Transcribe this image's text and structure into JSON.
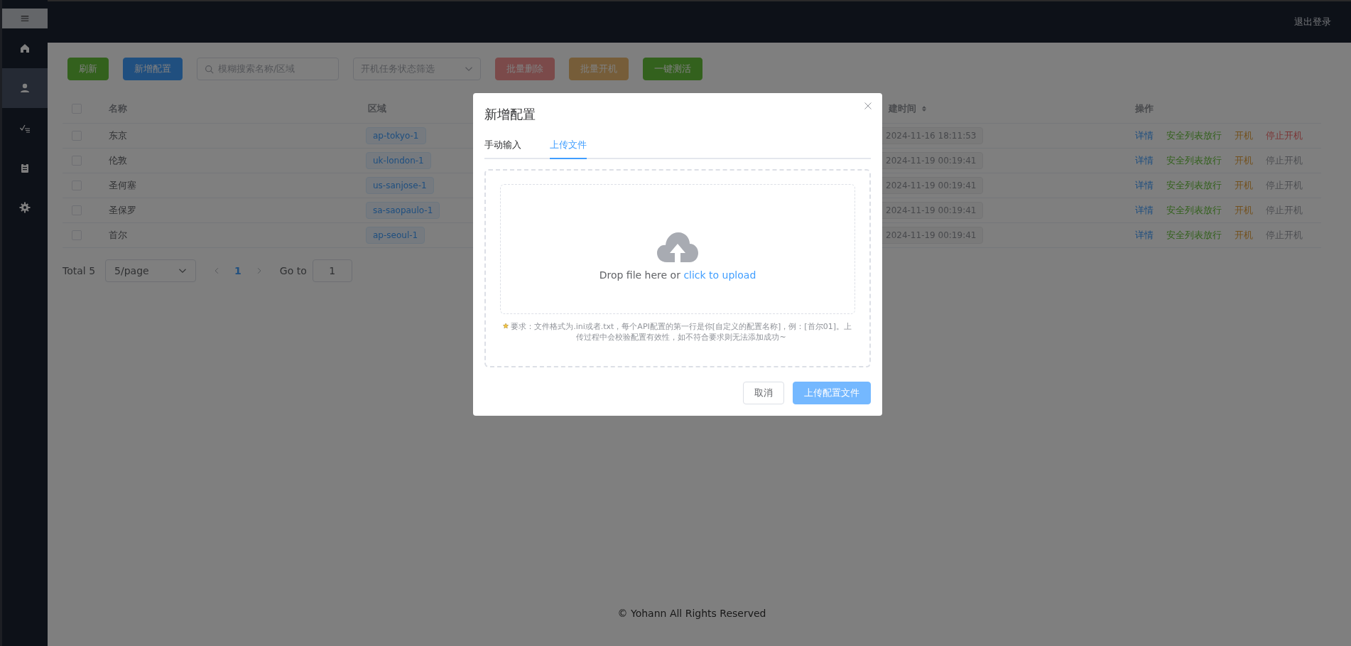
{
  "sidebar": {
    "collapsed": true,
    "items": [
      {
        "selected": false
      },
      {
        "selected": true
      },
      {
        "selected": false
      },
      {
        "selected": false
      },
      {
        "selected": false
      }
    ]
  },
  "header": {
    "logout": "退出登录"
  },
  "toolbar": {
    "buttons": [
      {
        "label": "刷新",
        "kind": "success",
        "disabled": false
      },
      {
        "label": "新增配置",
        "kind": "primary",
        "disabled": false
      }
    ],
    "search": {
      "placeholder": "模糊搜索名称/区域"
    },
    "status_filter": {
      "placeholder": "开机任务状态筛选"
    },
    "batch_buttons": [
      {
        "label": "批量删除",
        "kind": "danger",
        "disabled": true
      },
      {
        "label": "批量开机",
        "kind": "warning",
        "disabled": true
      },
      {
        "label": "一键测活",
        "kind": "success",
        "disabled": false
      }
    ]
  },
  "table": {
    "columns": [
      "名称",
      "区域",
      "建时间",
      "操作"
    ],
    "select_all_checked": false,
    "rows": [
      {
        "checked": false,
        "name": "东京",
        "region": "ap-tokyo-1",
        "created": "2024-11-16 18:11:53",
        "actions": [
          {
            "label": "详情",
            "kind": "info",
            "disabled": false
          },
          {
            "label": "安全列表放行",
            "kind": "success",
            "disabled": false
          },
          {
            "label": "开机",
            "kind": "warning",
            "disabled": false
          },
          {
            "label": "停止开机",
            "kind": "danger",
            "disabled": false
          }
        ]
      },
      {
        "checked": false,
        "name": "伦敦",
        "region": "uk-london-1",
        "created": "2024-11-19 00:19:41",
        "actions": [
          {
            "label": "详情",
            "kind": "info",
            "disabled": false
          },
          {
            "label": "安全列表放行",
            "kind": "success",
            "disabled": false
          },
          {
            "label": "开机",
            "kind": "warning",
            "disabled": false
          },
          {
            "label": "停止开机",
            "kind": "danger",
            "disabled": true
          }
        ]
      },
      {
        "checked": false,
        "name": "圣何塞",
        "region": "us-sanjose-1",
        "created": "2024-11-19 00:19:41",
        "actions": [
          {
            "label": "详情",
            "kind": "info",
            "disabled": false
          },
          {
            "label": "安全列表放行",
            "kind": "success",
            "disabled": false
          },
          {
            "label": "开机",
            "kind": "warning",
            "disabled": false
          },
          {
            "label": "停止开机",
            "kind": "danger",
            "disabled": true
          }
        ]
      },
      {
        "checked": false,
        "name": "圣保罗",
        "region": "sa-saopaulo-1",
        "created": "2024-11-19 00:19:41",
        "actions": [
          {
            "label": "详情",
            "kind": "info",
            "disabled": false
          },
          {
            "label": "安全列表放行",
            "kind": "success",
            "disabled": false
          },
          {
            "label": "开机",
            "kind": "warning",
            "disabled": false
          },
          {
            "label": "停止开机",
            "kind": "danger",
            "disabled": true
          }
        ]
      },
      {
        "checked": false,
        "name": "首尔",
        "region": "ap-seoul-1",
        "created": "2024-11-19 00:19:41",
        "actions": [
          {
            "label": "详情",
            "kind": "info",
            "disabled": false
          },
          {
            "label": "安全列表放行",
            "kind": "success",
            "disabled": false
          },
          {
            "label": "开机",
            "kind": "warning",
            "disabled": false
          },
          {
            "label": "停止开机",
            "kind": "danger",
            "disabled": true
          }
        ]
      }
    ]
  },
  "pagination": {
    "total": "Total 5",
    "page_size": "5/page",
    "pages": [
      {
        "label": "1",
        "selected": true
      }
    ],
    "goto_label": "Go to",
    "goto_value": "1"
  },
  "footer": "© Yohann All Rights Reserved",
  "dialog": {
    "title": "新增配置",
    "tabs": [
      {
        "label": "手动输入",
        "selected": false
      },
      {
        "label": "上传文件",
        "selected": true
      }
    ],
    "drop_text": "Drop file here or ",
    "upload_link": "click to upload",
    "note": "要求：文件格式为.ini或者.txt，每个API配置的第一行是你[自定义的配置名称]，例：[首尔01]。上传过程中会校验配置有效性，如不符合要求则无法添加成功~",
    "buttons": [
      {
        "label": "取消",
        "kind": "default"
      },
      {
        "label": "上传配置文件",
        "kind": "primary",
        "disabled": true
      }
    ]
  }
}
